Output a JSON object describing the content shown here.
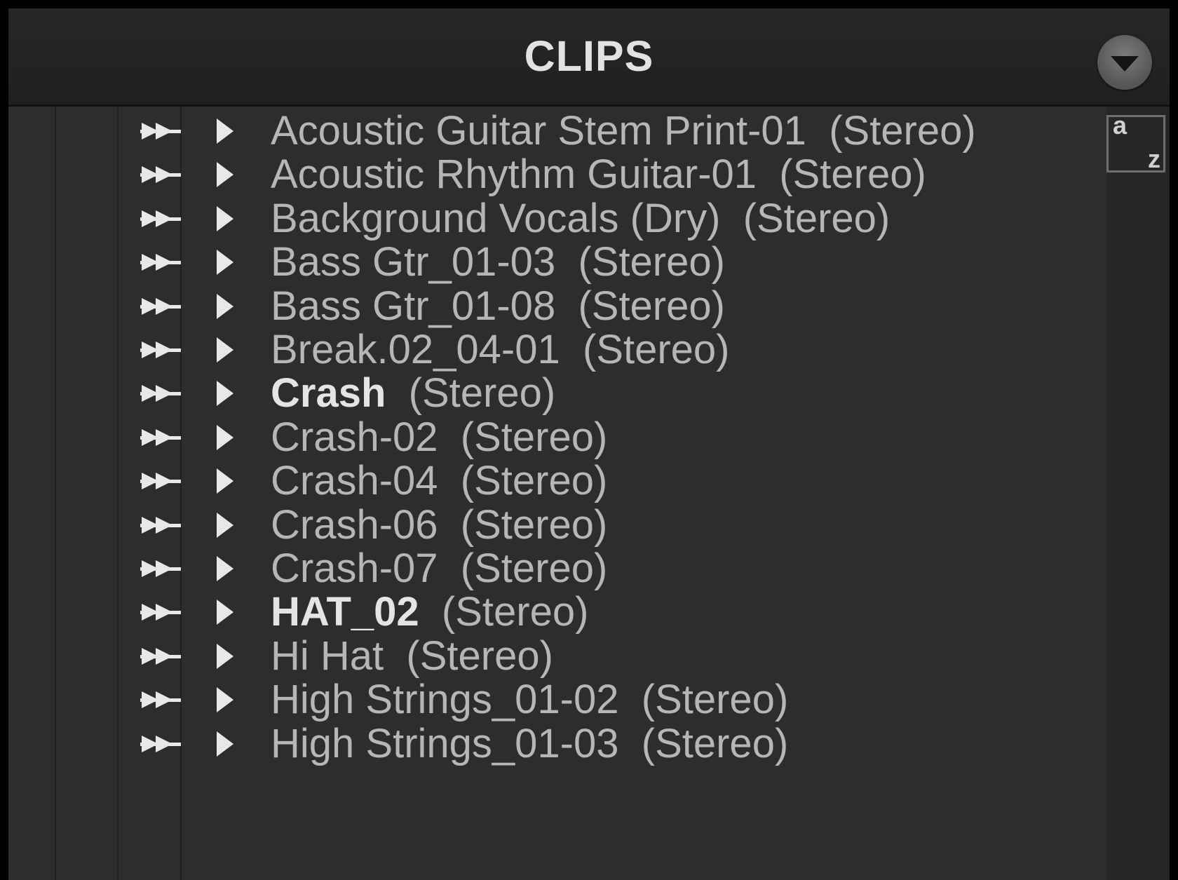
{
  "header": {
    "title": "CLIPS",
    "menu_icon": "chevron-down-icon"
  },
  "sort_button": {
    "icon": "sort-alphabetical-icon",
    "letter_a": "a",
    "letter_z": "z"
  },
  "clips": [
    {
      "name": "Acoustic Guitar Stem Print-01",
      "suffix": "(Stereo)",
      "bold": false
    },
    {
      "name": "Acoustic Rhythm Guitar-01",
      "suffix": "(Stereo)",
      "bold": false
    },
    {
      "name": "Background Vocals (Dry)",
      "suffix": "(Stereo)",
      "bold": false
    },
    {
      "name": "Bass Gtr_01-03",
      "suffix": "(Stereo)",
      "bold": false
    },
    {
      "name": "Bass Gtr_01-08",
      "suffix": "(Stereo)",
      "bold": false
    },
    {
      "name": "Break.02_04-01",
      "suffix": "(Stereo)",
      "bold": false
    },
    {
      "name": "Crash",
      "suffix": "(Stereo)",
      "bold": true
    },
    {
      "name": "Crash-02",
      "suffix": "(Stereo)",
      "bold": false
    },
    {
      "name": "Crash-04",
      "suffix": "(Stereo)",
      "bold": false
    },
    {
      "name": "Crash-06",
      "suffix": "(Stereo)",
      "bold": false
    },
    {
      "name": "Crash-07",
      "suffix": "(Stereo)",
      "bold": false
    },
    {
      "name": "HAT_02",
      "suffix": "(Stereo)",
      "bold": true
    },
    {
      "name": "Hi Hat",
      "suffix": "(Stereo)",
      "bold": false
    },
    {
      "name": "High Strings_01-02",
      "suffix": "(Stereo)",
      "bold": false
    },
    {
      "name": "High Strings_01-03",
      "suffix": "(Stereo)",
      "bold": false
    }
  ],
  "row_icons": {
    "drag": "double-arrow-drag-icon",
    "expand": "disclosure-triangle-icon"
  },
  "colors": {
    "background": "#2d2d2d",
    "header": "#222325",
    "text": "#b6b6b6",
    "text_bold": "#e4e4e4"
  }
}
